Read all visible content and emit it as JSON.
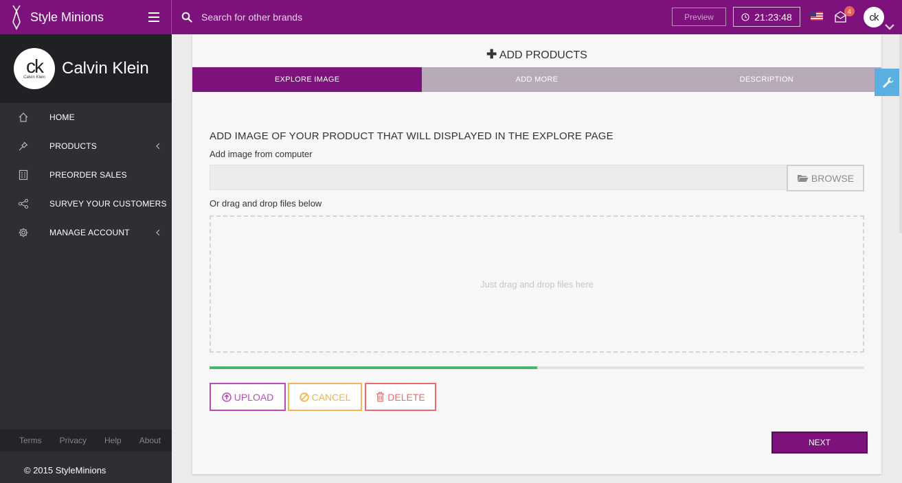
{
  "app": {
    "name": "Style Minions"
  },
  "topbar": {
    "search_placeholder": "Search for other brands",
    "preview_label": "Preview",
    "clock_time": "21:23:48",
    "mail_badge_count": "4",
    "language_flag": "us-flag-icon"
  },
  "sidebar": {
    "brand_name": "Calvin Klein",
    "avatar_text": "ck",
    "avatar_subtext": "Calvin Klein",
    "items": [
      {
        "label": "HOME",
        "icon": "home-icon",
        "has_submenu": false
      },
      {
        "label": "PRODUCTS",
        "icon": "pin-icon",
        "has_submenu": true
      },
      {
        "label": "PREORDER SALES",
        "icon": "calculator-icon",
        "has_submenu": false
      },
      {
        "label": "SURVEY YOUR CUSTOMERS",
        "icon": "share-icon",
        "has_submenu": false
      },
      {
        "label": "MANAGE ACCOUNT",
        "icon": "gear-icon",
        "has_submenu": true
      }
    ],
    "footer_links": [
      "Terms",
      "Privacy",
      "Help",
      "About"
    ],
    "copyright": "© 2015 StyleMinions"
  },
  "main": {
    "title": "ADD PRODUCTS",
    "tabs": [
      {
        "label": "EXPLORE IMAGE",
        "active": true
      },
      {
        "label": "ADD MORE",
        "active": false
      },
      {
        "label": "DESCRIPTION",
        "active": false
      }
    ],
    "section_title": "ADD IMAGE OF YOUR PRODUCT THAT WILL DISPLAYED IN THE EXPLORE PAGE",
    "file_label": "Add image from computer",
    "browse_label": "BROWSE",
    "drag_label": "Or drag and drop files below",
    "dropzone_text": "Just drag and drop files here",
    "upload_progress_percent": 50,
    "upload_label": "UPLOAD",
    "cancel_label": "CANCEL",
    "delete_label": "DELETE",
    "next_label": "NEXT"
  },
  "colors": {
    "brand_purple": "#7d127d",
    "sidebar_dark": "#2d2f33",
    "progress_green": "#47b86a",
    "upload": "#b94bb9",
    "cancel": "#f0b455",
    "delete": "#ec6a6a",
    "settings_blue": "#5aaee0"
  }
}
